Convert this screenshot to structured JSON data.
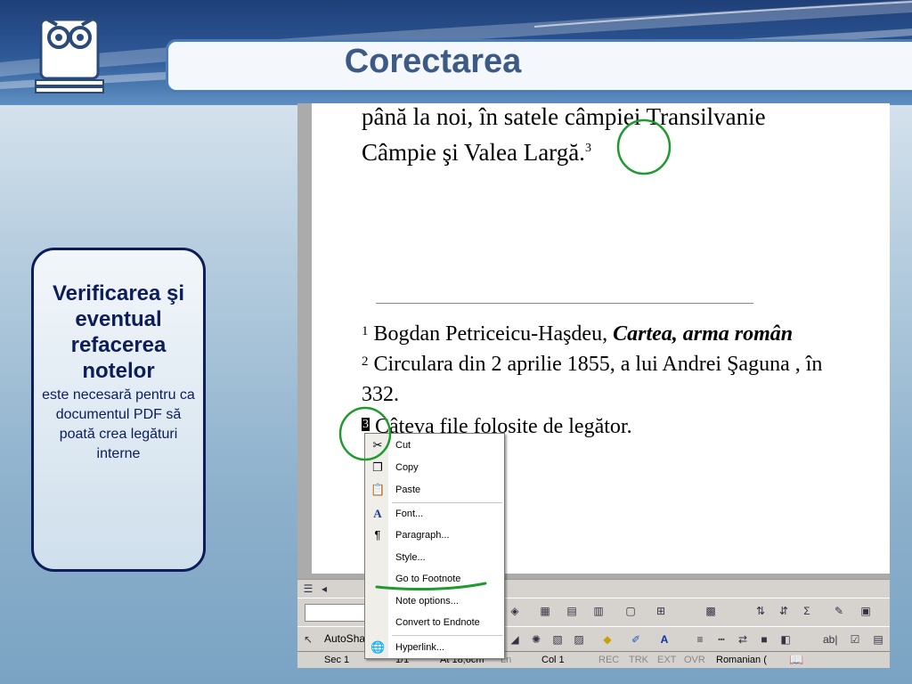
{
  "slide": {
    "title": "Corectarea",
    "sidebar": {
      "heading": "Verificarea şi eventual refacerea notelor",
      "text": "este necesară pentru ca documentul PDF să poată crea legături interne"
    }
  },
  "document": {
    "body_line1": "până la noi, în satele câmpiei Transilvanie",
    "body_line2": "Câmpie şi Valea Largă.",
    "body_ref": "3",
    "footnotes": [
      {
        "num": "1",
        "text": "Bogdan Petriceicu-Haşdeu, ",
        "emph": "Cartea, arma român"
      },
      {
        "num": "2",
        "text": "Circulara din 2 aprilie 1855, a lui Andrei Şaguna , în"
      },
      {
        "num": "",
        "text": "332."
      },
      {
        "num": "3",
        "text": "Câteva file folosite de legător."
      }
    ]
  },
  "context_menu": {
    "items": [
      {
        "label": "Cut",
        "icon": "scissors-icon"
      },
      {
        "label": "Copy",
        "icon": "copy-icon"
      },
      {
        "label": "Paste",
        "icon": "paste-icon"
      },
      {
        "label": "Font...",
        "icon": "font-icon"
      },
      {
        "label": "Paragraph...",
        "icon": "paragraph-icon"
      },
      {
        "label": "Style...",
        "icon": ""
      },
      {
        "label": "Go to Footnote",
        "icon": ""
      },
      {
        "label": "Note options...",
        "icon": ""
      },
      {
        "label": "Convert to Endnote",
        "icon": ""
      },
      {
        "label": "Hyperlink...",
        "icon": "hyperlink-icon"
      }
    ]
  },
  "drawing_toolbar": {
    "autoshapes": "AutoSha"
  },
  "statusbar": {
    "sec": "Sec 1",
    "page": "1/1",
    "at": "At 18,6cm",
    "ln": "Ln",
    "col": "Col 1",
    "rec": "REC",
    "trk": "TRK",
    "ext": "EXT",
    "ovr": "OVR",
    "language": "Romanian ("
  },
  "colors": {
    "accent": "#4a7cb9",
    "annotation": "#1e9a2e",
    "card_border": "#0c1d5a"
  }
}
